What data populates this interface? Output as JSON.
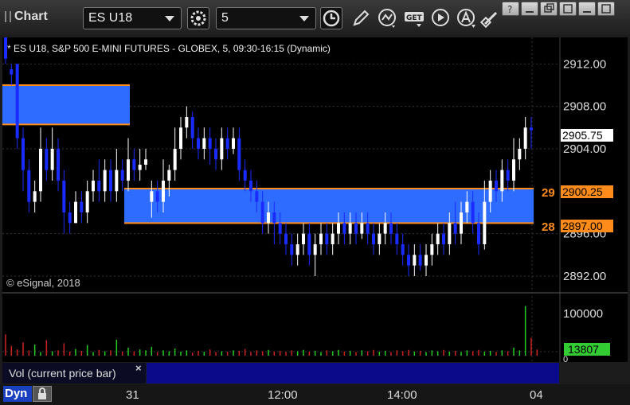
{
  "window": {
    "title": "Chart"
  },
  "toolbar": {
    "symbol_value": "ES U18",
    "interval_value": "5"
  },
  "chart": {
    "description": "* ES U18, S&P 500 E-MINI FUTURES - GLOBEX, 5, 09:30-16:15 (Dynamic)",
    "copyright": "© eSignal, 2018",
    "price_ticks": [
      "2912.00",
      "2908.00",
      "2904.00",
      "2896.00",
      "2892.00"
    ],
    "last_price": "2905.75",
    "level_high": "2900.25",
    "level_low": "2897.00",
    "level_high_left": "29",
    "level_low_left": "28",
    "volume_tick": "100000",
    "volume_tick_zero": "0",
    "volume_last": "13807",
    "volume_label": "Vol (current price bar)",
    "close_symbol": "×",
    "time_ticks": [
      "31",
      "12:00",
      "14:00",
      "04"
    ],
    "dynamic_label": "Dyn"
  },
  "colors": {
    "up_candle": "#ffffff",
    "down_candle": "#1a2bff",
    "zone": "#2e6bff",
    "zone_border": "#ff8c1a",
    "vol_up": "#22cc22",
    "vol_down": "#cc2222",
    "last_price_bg": "#ffffff",
    "level_bg": "#ff8c1a",
    "volume_last_bg": "#33cc33"
  },
  "chart_data": {
    "type": "candlestick",
    "y_range": [
      2890.5,
      2914.5
    ],
    "volume_range": [
      0,
      140000
    ],
    "series": [
      {
        "name": "price",
        "values": [
          [
            2915,
            2912.5,
            2915,
            2912
          ],
          [
            2911.5,
            2911,
            2910,
            2912
          ],
          [
            2912,
            2905,
            2912,
            2904
          ],
          [
            2905,
            2902,
            2906,
            2900
          ],
          [
            2902,
            2899,
            2903,
            2898
          ],
          [
            2899,
            2900,
            2901,
            2898
          ],
          [
            2900,
            2904,
            2906,
            2899
          ],
          [
            2904,
            2902,
            2905,
            2901
          ],
          [
            2902,
            2904,
            2906,
            2901
          ],
          [
            2904,
            2901,
            2905,
            2900
          ],
          [
            2901,
            2898,
            2902,
            2896
          ],
          [
            2898,
            2897,
            2899,
            2896
          ],
          [
            2897,
            2899,
            2900,
            2897
          ],
          [
            2899,
            2898,
            2900,
            2897
          ],
          [
            2898,
            2900,
            2901,
            2897
          ],
          [
            2900,
            2901,
            2902,
            2899
          ],
          [
            2901,
            2900,
            2903,
            2899
          ],
          [
            2900,
            2902,
            2903,
            2899
          ],
          [
            2902,
            2900,
            2903,
            2899
          ],
          [
            2900,
            2902,
            2904,
            2899
          ],
          [
            2902,
            2901,
            2903,
            2900
          ],
          [
            2901,
            2903,
            2905,
            2900
          ],
          [
            2903,
            2902,
            2904,
            2901
          ],
          [
            2902,
            2902.5,
            2904,
            2901
          ],
          [
            2902.5,
            2903,
            2904,
            2902
          ],
          [
            2899,
            2900,
            2901,
            2897.5
          ],
          [
            2900,
            2899,
            2901,
            2898
          ],
          [
            2899,
            2901,
            2903,
            2898
          ],
          [
            2901,
            2902,
            2902.5,
            2899.5
          ],
          [
            2902,
            2904,
            2906,
            2901
          ],
          [
            2904,
            2906,
            2907,
            2903
          ],
          [
            2906,
            2907,
            2908,
            2905
          ],
          [
            2907,
            2905,
            2907.5,
            2904
          ],
          [
            2905,
            2904,
            2906,
            2903
          ],
          [
            2904,
            2905,
            2906,
            2903
          ],
          [
            2905,
            2904,
            2906,
            2902.5
          ],
          [
            2904,
            2903,
            2905,
            2902
          ],
          [
            2903,
            2905,
            2906,
            2902
          ],
          [
            2905,
            2904,
            2906,
            2903
          ],
          [
            2904,
            2905,
            2906,
            2903.5
          ],
          [
            2905,
            2902,
            2906,
            2901
          ],
          [
            2902,
            2901,
            2903,
            2900
          ],
          [
            2901,
            2900,
            2902,
            2899
          ],
          [
            2900,
            2899,
            2901,
            2898
          ],
          [
            2899,
            2897,
            2900,
            2896
          ],
          [
            2897,
            2898,
            2899,
            2896
          ],
          [
            2898,
            2897,
            2899,
            2895
          ],
          [
            2897,
            2896,
            2898,
            2895
          ],
          [
            2896,
            2895,
            2897,
            2894
          ],
          [
            2895,
            2894,
            2896,
            2893
          ],
          [
            2894,
            2895,
            2896,
            2893
          ],
          [
            2895,
            2896,
            2897,
            2894
          ],
          [
            2896,
            2894,
            2897,
            2893
          ],
          [
            2894,
            2895,
            2896,
            2892
          ],
          [
            2895,
            2896,
            2897,
            2894
          ],
          [
            2896,
            2895,
            2897,
            2894
          ],
          [
            2895,
            2896,
            2897,
            2894
          ],
          [
            2896,
            2897,
            2898,
            2895
          ],
          [
            2897,
            2896,
            2898,
            2895
          ],
          [
            2896,
            2897,
            2898,
            2895
          ],
          [
            2897,
            2896,
            2898,
            2895
          ],
          [
            2896,
            2897,
            2898,
            2895.5
          ],
          [
            2897,
            2896,
            2898,
            2895
          ],
          [
            2896,
            2895,
            2897,
            2894
          ],
          [
            2895,
            2896,
            2897,
            2894
          ],
          [
            2896,
            2897,
            2898,
            2895
          ],
          [
            2897,
            2896,
            2898,
            2895
          ],
          [
            2896,
            2895,
            2897,
            2894
          ],
          [
            2895,
            2894,
            2896,
            2893
          ],
          [
            2894,
            2893,
            2895,
            2892
          ],
          [
            2893,
            2894,
            2895,
            2892
          ],
          [
            2894,
            2893,
            2895,
            2892.5
          ],
          [
            2893,
            2894,
            2895,
            2892
          ],
          [
            2894,
            2895,
            2896,
            2893
          ],
          [
            2895,
            2896,
            2897,
            2894
          ],
          [
            2896,
            2895,
            2897,
            2894
          ],
          [
            2895,
            2897,
            2898,
            2894
          ],
          [
            2897,
            2896,
            2899,
            2895
          ],
          [
            2896,
            2898,
            2899,
            2895
          ],
          [
            2898,
            2899,
            2900,
            2897
          ],
          [
            2899,
            2897,
            2900,
            2896
          ],
          [
            2897,
            2895,
            2898,
            2894
          ],
          [
            2895,
            2899,
            2901,
            2894.5
          ],
          [
            2899,
            2901,
            2902,
            2898
          ],
          [
            2901,
            2900,
            2902,
            2899
          ],
          [
            2900,
            2902,
            2903,
            2899
          ],
          [
            2902,
            2901,
            2903,
            2900
          ],
          [
            2901,
            2903,
            2905,
            2900
          ],
          [
            2903,
            2904,
            2905,
            2902
          ],
          [
            2904,
            2906,
            2907,
            2903
          ],
          [
            2906,
            2905.75,
            2907,
            2904
          ]
        ]
      },
      {
        "name": "volume",
        "values": [
          48000,
          22000,
          14000,
          30000,
          12000,
          25000,
          8000,
          35000,
          10000,
          12000,
          28000,
          9000,
          15000,
          11000,
          24000,
          8000,
          13000,
          10000,
          12000,
          36000,
          9000,
          18000,
          10000,
          14000,
          12000,
          20000,
          8000,
          12000,
          10000,
          16000,
          9000,
          12000,
          7000,
          11000,
          9000,
          14000,
          8000,
          10000,
          9000,
          12000,
          11000,
          15000,
          8000,
          12000,
          10000,
          13000,
          9000,
          11000,
          8000,
          12000,
          10000,
          13000,
          9000,
          11000,
          8000,
          12000,
          10000,
          13000,
          9000,
          11000,
          8000,
          12000,
          10000,
          13000,
          9000,
          11000,
          8000,
          12000,
          10000,
          13000,
          9000,
          11000,
          8000,
          12000,
          10000,
          13000,
          9000,
          11000,
          8000,
          12000,
          10000,
          13000,
          9000,
          11000,
          8000,
          12000,
          10000,
          18000,
          12000,
          112000,
          40000,
          13807
        ]
      }
    ],
    "zones": [
      {
        "top": 2910,
        "bottom": 2906.3
      },
      {
        "top": 2900.25,
        "bottom": 2897.0
      }
    ]
  }
}
